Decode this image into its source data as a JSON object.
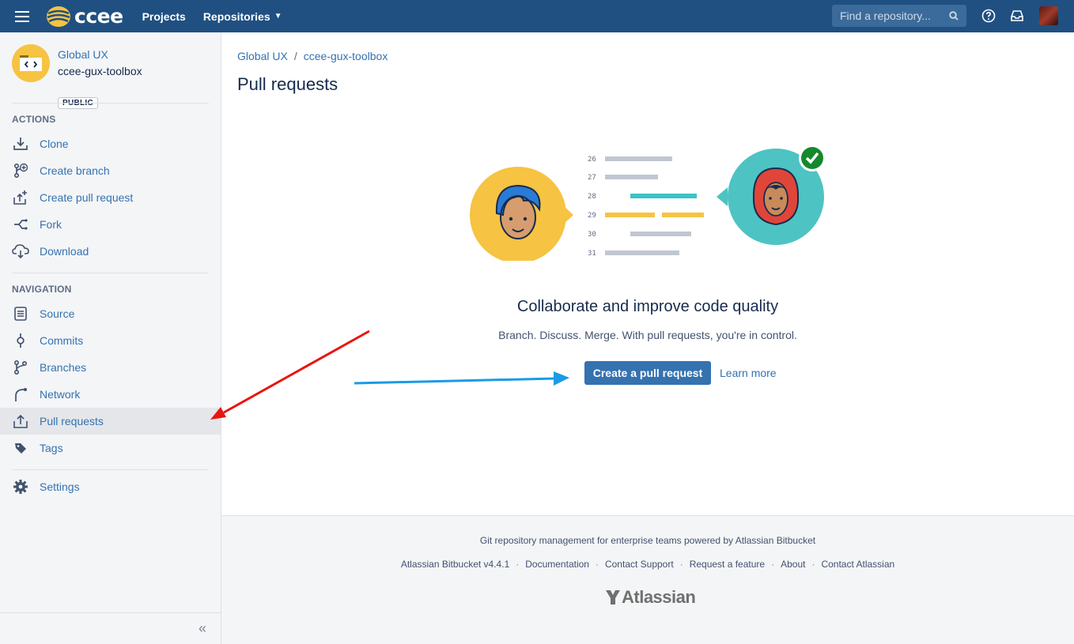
{
  "header": {
    "logo_text": "ccee",
    "nav": {
      "projects": "Projects",
      "repositories": "Repositories"
    },
    "search": {
      "placeholder": "Find a repository..."
    },
    "brand_color": "#205081"
  },
  "sidebar": {
    "project_name": "Global UX",
    "repo_name": "ccee-gux-toolbox",
    "visibility_badge": "PUBLIC",
    "actions_title": "ACTIONS",
    "actions": [
      {
        "label": "Clone",
        "icon": "download-icon"
      },
      {
        "label": "Create branch",
        "icon": "branch-plus-icon"
      },
      {
        "label": "Create pull request",
        "icon": "pull-request-plus-icon"
      },
      {
        "label": "Fork",
        "icon": "fork-icon"
      },
      {
        "label": "Download",
        "icon": "cloud-download-icon"
      }
    ],
    "navigation_title": "NAVIGATION",
    "navigation": [
      {
        "label": "Source",
        "icon": "source-icon"
      },
      {
        "label": "Commits",
        "icon": "commit-icon"
      },
      {
        "label": "Branches",
        "icon": "branch-icon"
      },
      {
        "label": "Network",
        "icon": "network-icon"
      },
      {
        "label": "Pull requests",
        "icon": "pull-request-icon",
        "active": true
      },
      {
        "label": "Tags",
        "icon": "tag-icon"
      }
    ],
    "settings": {
      "label": "Settings",
      "icon": "gear-icon"
    },
    "collapse_glyph": "«"
  },
  "main": {
    "breadcrumb": {
      "project": "Global UX",
      "separator": "/",
      "repo": "ccee-gux-toolbox"
    },
    "title": "Pull requests",
    "illustration": {
      "line_numbers": [
        "26",
        "27",
        "28",
        "29",
        "30",
        "31"
      ]
    },
    "empty_title": "Collaborate and improve code quality",
    "empty_subtitle": "Branch. Discuss. Merge. With pull requests, you're in control.",
    "create_button": "Create a pull request",
    "learn_more": "Learn more"
  },
  "footer": {
    "tagline": "Git repository management for enterprise teams powered by Atlassian Bitbucket",
    "links": [
      "Atlassian Bitbucket v4.4.1",
      "Documentation",
      "Contact Support",
      "Request a feature",
      "About",
      "Contact Atlassian"
    ],
    "logo_text": "Atlassian"
  },
  "annotation_colors": {
    "red_arrow": "#e8150f",
    "blue_arrow": "#1a9be6"
  }
}
